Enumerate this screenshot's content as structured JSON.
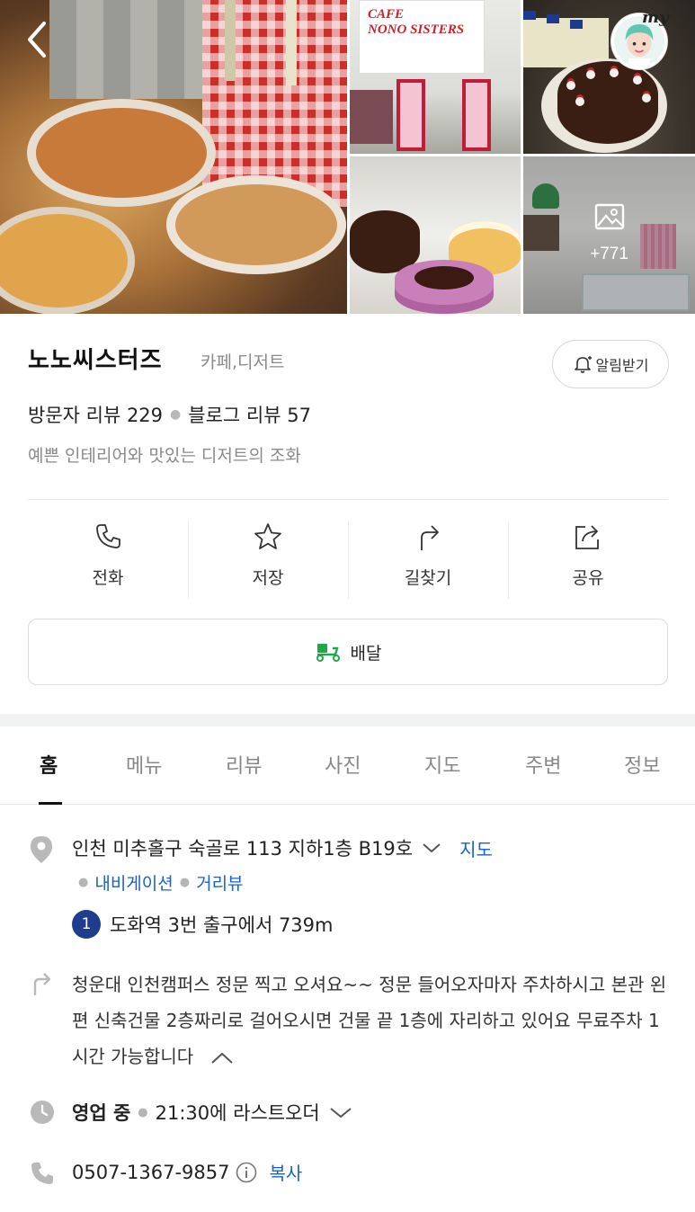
{
  "gallery": {
    "more_count": "+771",
    "signboard_text": [
      "CAFE",
      "NONO SISTERS"
    ],
    "my_label": "my"
  },
  "place": {
    "name": "노노씨스터즈",
    "category": "카페,디저트",
    "notify_label": "알림받기",
    "visitor_reviews": "방문자 리뷰 229",
    "blog_reviews": "블로그 리뷰 57",
    "tagline": "예쁜 인테리어와 맛있는 디저트의 조화"
  },
  "actions": [
    {
      "label": "전화",
      "icon": "phone-icon"
    },
    {
      "label": "저장",
      "icon": "star-icon"
    },
    {
      "label": "길찾기",
      "icon": "directions-icon"
    },
    {
      "label": "공유",
      "icon": "share-icon"
    }
  ],
  "delivery": {
    "label": "배달",
    "icon": "delivery-scooter-icon"
  },
  "tabs": [
    "홈",
    "메뉴",
    "리뷰",
    "사진",
    "지도",
    "주변",
    "정보"
  ],
  "active_tab": "홈",
  "details": {
    "address": "인천 미추홀구 숙골로 113 지하1층 B19호",
    "map_link": "지도",
    "navigation_link": "내비게이션",
    "street_view_link": "거리뷰",
    "subway_line": "1",
    "subway_text": "도화역 3번 출구에서 739m",
    "directions": "청운대 인천캠퍼스 정문 찍고 오셔요~~ 정문 들어오자마자 주차하시고 본관 왼편 신축건물 2층짜리로 걸어오시면 건물 끝 1층에 자리하고 있어요 무료주차 1시간 가능합니다",
    "hours_status": "영업 중",
    "hours_text": "21:30에 라스트오더",
    "phone": "0507-1367-9857",
    "copy_label": "복사"
  },
  "colors": {
    "link_blue": "#1a62c9",
    "subway_line_1": "#1f3d8e",
    "delivery_green": "#1ea84a",
    "muted_text": "#8a8a8a"
  }
}
